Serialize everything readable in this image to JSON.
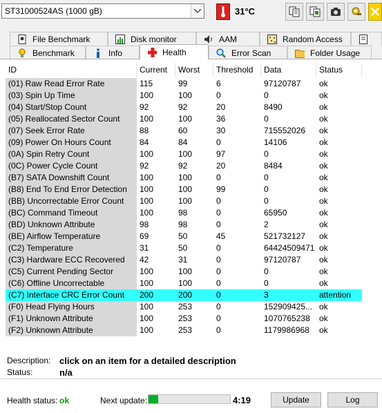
{
  "toolbar": {
    "drive": "ST31000524AS (1000 gB)",
    "temperature": "31°C",
    "buttons": [
      "copy-icon",
      "copy-all-icon",
      "camera-icon",
      "settings-icon",
      "close-icon"
    ]
  },
  "tabs_top": [
    {
      "label": "File Benchmark",
      "icon": "file-icon"
    },
    {
      "label": "Disk monitor",
      "icon": "chart-icon"
    },
    {
      "label": "AAM",
      "icon": "speaker-icon"
    },
    {
      "label": "Random Access",
      "icon": "grid-icon"
    }
  ],
  "tabs_bottom": [
    {
      "label": "Benchmark",
      "icon": "bulb-icon"
    },
    {
      "label": "Info",
      "icon": "info-icon"
    },
    {
      "label": "Health",
      "icon": "cross-icon",
      "active": true
    },
    {
      "label": "Error Scan",
      "icon": "magnifier-icon"
    },
    {
      "label": "Folder Usage",
      "icon": "folder-icon"
    }
  ],
  "table": {
    "headers": [
      "ID",
      "Current",
      "Worst",
      "Threshold",
      "Data",
      "Status"
    ],
    "rows": [
      [
        "(01) Raw Read Error Rate",
        "115",
        "99",
        "6",
        "97120787",
        "ok"
      ],
      [
        "(03) Spin Up Time",
        "100",
        "100",
        "0",
        "0",
        "ok"
      ],
      [
        "(04) Start/Stop Count",
        "92",
        "92",
        "20",
        "8490",
        "ok"
      ],
      [
        "(05) Reallocated Sector Count",
        "100",
        "100",
        "36",
        "0",
        "ok"
      ],
      [
        "(07) Seek Error Rate",
        "88",
        "60",
        "30",
        "715552026",
        "ok"
      ],
      [
        "(09) Power On Hours Count",
        "84",
        "84",
        "0",
        "14106",
        "ok"
      ],
      [
        "(0A) Spin Retry Count",
        "100",
        "100",
        "97",
        "0",
        "ok"
      ],
      [
        "(0C) Power Cycle Count",
        "92",
        "92",
        "20",
        "8484",
        "ok"
      ],
      [
        "(B7) SATA Downshift Count",
        "100",
        "100",
        "0",
        "0",
        "ok"
      ],
      [
        "(B8) End To End Error Detection",
        "100",
        "100",
        "99",
        "0",
        "ok"
      ],
      [
        "(BB) Uncorrectable Error Count",
        "100",
        "100",
        "0",
        "0",
        "ok"
      ],
      [
        "(BC) Command Timeout",
        "100",
        "98",
        "0",
        "65950",
        "ok"
      ],
      [
        "(BD) Unknown Attribute",
        "98",
        "98",
        "0",
        "2",
        "ok"
      ],
      [
        "(BE) Airflow Temperature",
        "69",
        "50",
        "45",
        "521732127",
        "ok"
      ],
      [
        "(C2) Temperature",
        "31",
        "50",
        "0",
        "64424509471",
        "ok"
      ],
      [
        "(C3) Hardware ECC Recovered",
        "42",
        "31",
        "0",
        "97120787",
        "ok"
      ],
      [
        "(C5) Current Pending Sector",
        "100",
        "100",
        "0",
        "0",
        "ok"
      ],
      [
        "(C6) Offline Uncorrectable",
        "100",
        "100",
        "0",
        "0",
        "ok"
      ],
      [
        "(C7) Interface CRC Error Count",
        "200",
        "200",
        "0",
        "3",
        "attention"
      ],
      [
        "(F0) Head Flying Hours",
        "100",
        "253",
        "0",
        "152909425...",
        "ok"
      ],
      [
        "(F1) Unknown Attribute",
        "100",
        "253",
        "0",
        "1070765238",
        "ok"
      ],
      [
        "(F2) Unknown Attribute",
        "100",
        "253",
        "0",
        "1179986968",
        "ok"
      ]
    ],
    "selected_index": 18
  },
  "description": {
    "label": "Description:",
    "value": "click on an item for a detailed description",
    "status_label": "Status:",
    "status_value": "n/a"
  },
  "footer": {
    "health_label": "Health status:",
    "health_value": "ok",
    "next_update_label": "Next update:",
    "progress_fraction": 0.12,
    "next_update_time": "4:19",
    "update_button": "Update",
    "log_button": "Log"
  },
  "colors": {
    "selected_row": "#33ffff",
    "id_column_bg": "#d8d8d8",
    "health_ok": "#009a00",
    "progress_fill": "#06b025"
  }
}
